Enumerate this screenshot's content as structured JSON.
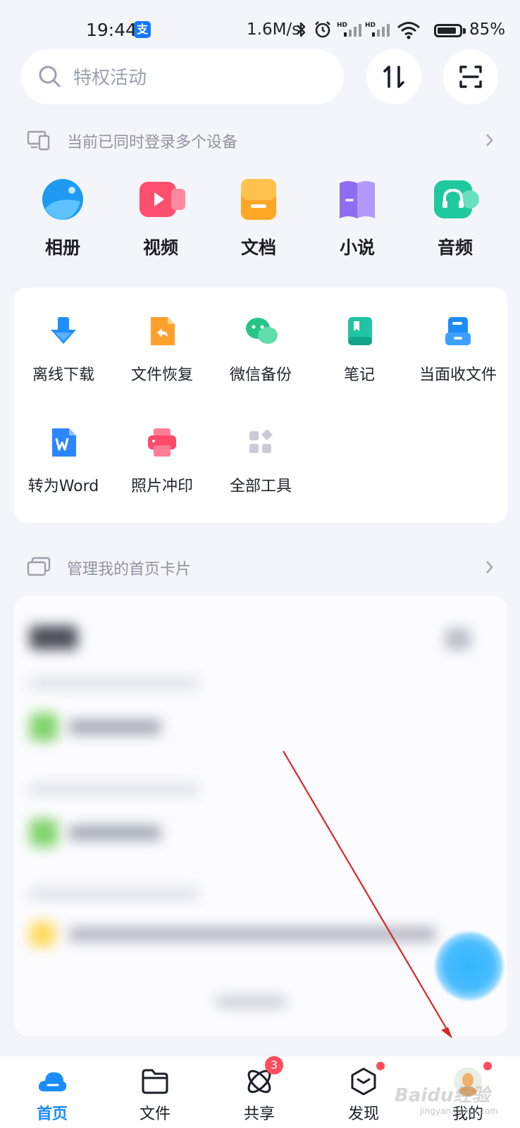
{
  "status_bar": {
    "time": "19:44",
    "pay_badge": "支",
    "net_speed": "1.6M/s",
    "battery_pct": "85%",
    "battery_level": 0.85
  },
  "search": {
    "placeholder": "特权活动"
  },
  "notices": {
    "devices": "当前已同时登录多个设备",
    "manage_cards": "管理我的首页卡片"
  },
  "categories": [
    {
      "label": "相册",
      "icon": "album-icon",
      "color": "#1e9bf0"
    },
    {
      "label": "视频",
      "icon": "video-icon",
      "color": "#ff4f6e"
    },
    {
      "label": "文档",
      "icon": "document-icon",
      "color": "#ffa726"
    },
    {
      "label": "小说",
      "icon": "novel-icon",
      "color": "#8f6cf0"
    },
    {
      "label": "音频",
      "icon": "audio-icon",
      "color": "#1fc9a0"
    }
  ],
  "tools": [
    {
      "label": "离线下载",
      "icon": "offline-download-icon",
      "color": "#1f8fff"
    },
    {
      "label": "文件恢复",
      "icon": "file-restore-icon",
      "color": "#ffa02b"
    },
    {
      "label": "微信备份",
      "icon": "wechat-backup-icon",
      "color": "#27c48a"
    },
    {
      "label": "笔记",
      "icon": "notes-icon",
      "color": "#20c4a4"
    },
    {
      "label": "当面收文件",
      "icon": "receive-files-icon",
      "color": "#1d8cf8"
    },
    {
      "label": "转为Word",
      "icon": "to-word-icon",
      "color": "#2b86ff"
    },
    {
      "label": "照片冲印",
      "icon": "photo-print-icon",
      "color": "#ff4a6b"
    },
    {
      "label": "全部工具",
      "icon": "all-tools-icon",
      "color": "#c9ccd6"
    }
  ],
  "nav": [
    {
      "label": "首页",
      "icon": "home-cloud-icon",
      "active": true
    },
    {
      "label": "文件",
      "icon": "folder-icon",
      "active": false
    },
    {
      "label": "共享",
      "icon": "share-atom-icon",
      "active": false,
      "badge": "3"
    },
    {
      "label": "发现",
      "icon": "discover-box-icon",
      "active": false,
      "dot": true
    },
    {
      "label": "我的",
      "icon": "profile-avatar-icon",
      "active": false,
      "dot": true
    }
  ],
  "watermark": {
    "text": "Baidu经验",
    "sub": "jingyan.baidu.com"
  },
  "colors": {
    "accent": "#1a8cff",
    "badge": "#ff4d5e",
    "background": "#f3f5fa"
  }
}
